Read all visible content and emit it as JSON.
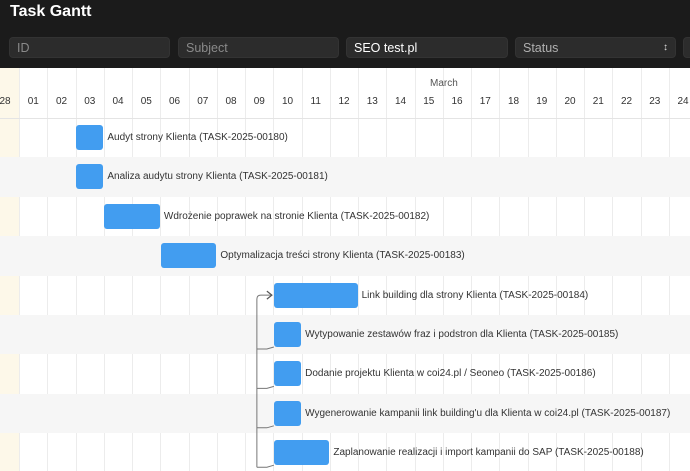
{
  "app": {
    "title": "Task Gantt"
  },
  "filters": {
    "id_placeholder": "ID",
    "subject_placeholder": "Subject",
    "project_value": "SEO test.pl",
    "status_label": "Status"
  },
  "timeline": {
    "month": "March",
    "days": [
      "28",
      "01",
      "02",
      "03",
      "04",
      "05",
      "06",
      "07",
      "08",
      "09",
      "10",
      "11",
      "12",
      "13",
      "14",
      "15",
      "16",
      "17",
      "18",
      "19",
      "20",
      "21",
      "22",
      "23",
      "24"
    ]
  },
  "tasks": [
    {
      "label": "Audyt strony Klienta (TASK-2025-00180)",
      "start": "03",
      "end": "03"
    },
    {
      "label": "Analiza audytu strony Klienta (TASK-2025-00181)",
      "start": "03",
      "end": "03"
    },
    {
      "label": "Wdrożenie poprawek na stronie Klienta (TASK-2025-00182)",
      "start": "04",
      "end": "05"
    },
    {
      "label": "Optymalizacja treści strony Klienta (TASK-2025-00183)",
      "start": "06",
      "end": "07"
    },
    {
      "label": "Link building dla strony Klienta (TASK-2025-00184)",
      "start": "10",
      "end": "12"
    },
    {
      "label": "Wytypowanie zestawów fraz i podstron dla Klienta (TASK-2025-00185)",
      "start": "10",
      "end": "10"
    },
    {
      "label": "Dodanie projektu Klienta w coi24.pl / Seoneo (TASK-2025-00186)",
      "start": "10",
      "end": "10"
    },
    {
      "label": "Wygenerowanie kampanii link building'u dla Klienta w coi24.pl (TASK-2025-00187)",
      "start": "10",
      "end": "10"
    },
    {
      "label": "Zaplanowanie realizacji i import kampanii do SAP (TASK-2025-00188)",
      "start": "10",
      "end": "11"
    }
  ],
  "colors": {
    "bar": "#429df0",
    "topbar": "#1b1b1b",
    "today": "#fdf8e9"
  },
  "icons": {
    "status_dropdown": "chevron-updown-icon",
    "dependency": "arrow-right-icon"
  }
}
